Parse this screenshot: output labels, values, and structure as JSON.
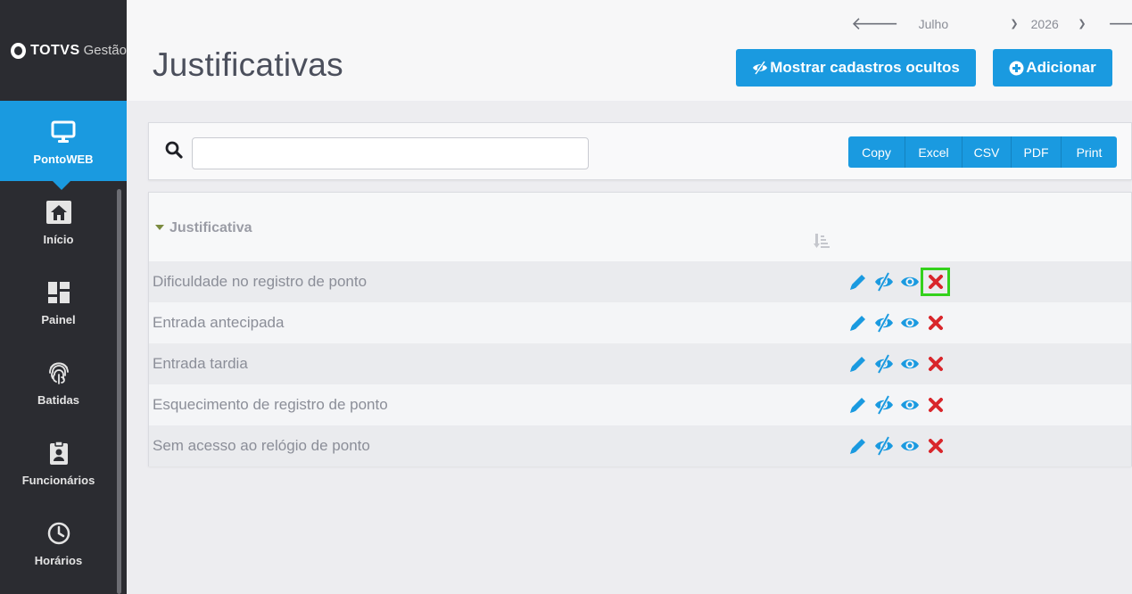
{
  "app": {
    "logo_brand": "TOTVS",
    "logo_sub": "Gestão"
  },
  "sidebar": {
    "items": [
      {
        "label": "PontoWEB",
        "icon": "monitor-icon",
        "active": true
      },
      {
        "label": "Início",
        "icon": "home-icon",
        "active": false
      },
      {
        "label": "Painel",
        "icon": "dashboard-icon",
        "active": false
      },
      {
        "label": "Batidas",
        "icon": "fingerprint-icon",
        "active": false
      },
      {
        "label": "Funcionários",
        "icon": "badge-icon",
        "active": false
      },
      {
        "label": "Horários",
        "icon": "clock-icon",
        "active": false
      }
    ]
  },
  "header": {
    "title": "Justificativas",
    "month": "Julho",
    "year": "2026",
    "show_hidden_label": "Mostrar cadastros ocultos",
    "add_label": "Adicionar"
  },
  "search": {
    "placeholder": "",
    "value": ""
  },
  "export": {
    "buttons": [
      "Copy",
      "Excel",
      "CSV",
      "PDF",
      "Print"
    ]
  },
  "table": {
    "header": "Justificativa",
    "rows": [
      "Dificuldade no registro de ponto",
      "Entrada antecipada",
      "Entrada tardia",
      "Esquecimento de registro de ponto",
      "Sem acesso ao relógio de ponto"
    ]
  },
  "colors": {
    "primary": "#1a9ae0",
    "sidebar": "#2b2c31",
    "delete": "#d9262b",
    "highlight": "#34d11c"
  }
}
